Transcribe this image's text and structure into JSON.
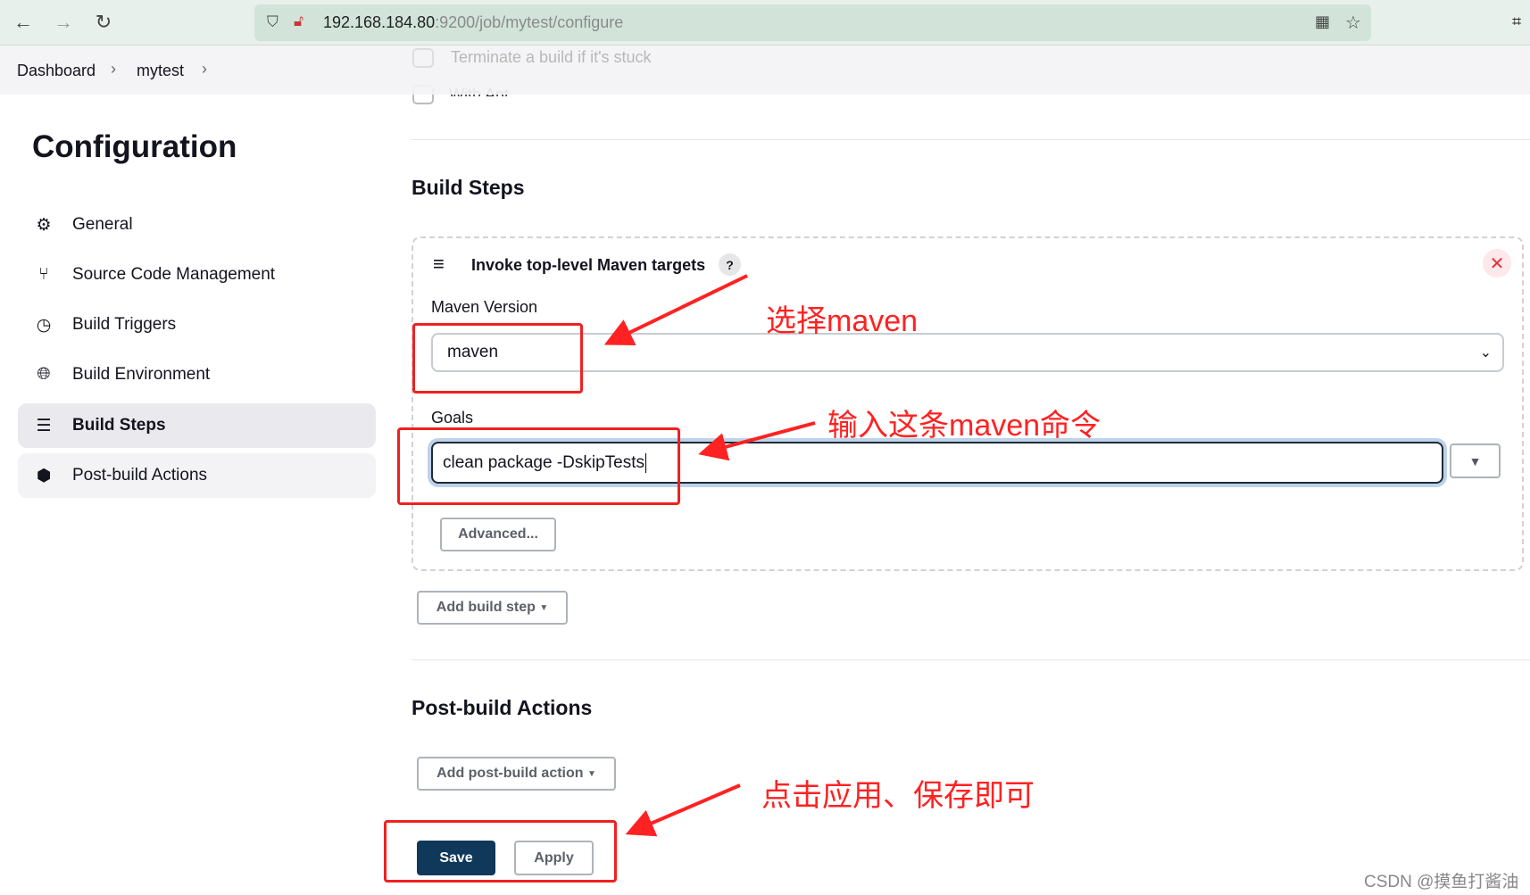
{
  "browser": {
    "url_host": "192.168.184.80",
    "url_path": ":9200/job/mytest/configure",
    "back": "←",
    "forward": "→",
    "reload": "↻"
  },
  "background_ghost": {
    "terminate": "Terminate a build if it's stuck",
    "with_ant": "With Ant"
  },
  "breadcrumb": [
    "Dashboard",
    "mytest"
  ],
  "sidebar": {
    "title": "Configuration",
    "items": [
      {
        "label": "General",
        "icon": "gear-icon"
      },
      {
        "label": "Source Code Management",
        "icon": "branch-icon"
      },
      {
        "label": "Build Triggers",
        "icon": "clock-icon"
      },
      {
        "label": "Build Environment",
        "icon": "globe-icon"
      },
      {
        "label": "Build Steps",
        "icon": "list-icon",
        "active": true
      },
      {
        "label": "Post-build Actions",
        "icon": "package-icon"
      }
    ]
  },
  "build_steps": {
    "heading": "Build Steps",
    "step_title": "Invoke top-level Maven targets",
    "help": "?",
    "maven_version_label": "Maven Version",
    "maven_version": "maven",
    "goals_label": "Goals",
    "goals_value": "clean package -DskipTests",
    "advanced": "Advanced...",
    "add_step": "Add build step"
  },
  "post_build": {
    "heading": "Post-build Actions",
    "add_action": "Add post-build action"
  },
  "actions": {
    "save": "Save",
    "apply": "Apply"
  },
  "annotations": {
    "a1": "选择maven",
    "a2": "输入这条maven命令",
    "a3": "点击应用、保存即可",
    "color": "#ff2222"
  },
  "watermark": "CSDN @摸鱼打酱油"
}
